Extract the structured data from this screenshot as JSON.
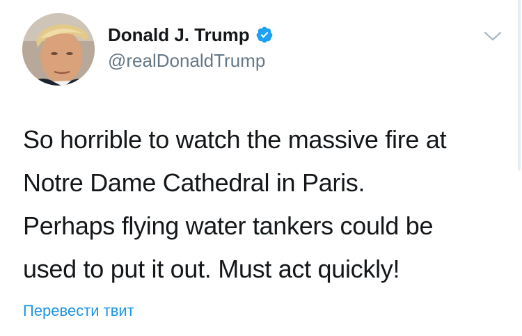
{
  "tweet": {
    "author": {
      "display_name": "Donald J. Trump",
      "handle": "@realDonaldTrump",
      "verified": true,
      "avatar_icon": "profile-photo"
    },
    "text_lines": [
      "So horrible to watch the massive fire at",
      "Notre Dame Cathedral in Paris.",
      "Perhaps flying water tankers could be",
      "used to put it out. Must act quickly!"
    ],
    "translate_label": "Перевести твит",
    "menu_icon": "chevron-down-icon"
  },
  "colors": {
    "text": "#14171a",
    "secondary_text": "#657786",
    "link": "#1b95e0",
    "verified_badge": "#1da1f2",
    "background": "#ffffff"
  }
}
